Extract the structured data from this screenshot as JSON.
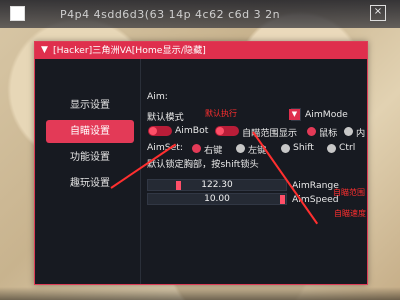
{
  "overlay": {
    "top_text": "P4p4 4sdd6d3(63 14p 4c62 c6d 3 2n",
    "close_symbol": "×"
  },
  "window": {
    "title": "[Hacker]三角洲VA[Home显示/隐藏]",
    "title_arrow": "▼"
  },
  "sidebar": {
    "items": [
      {
        "label": "显示设置",
        "active": false
      },
      {
        "label": "自瞄设置",
        "active": true
      },
      {
        "label": "功能设置",
        "active": false
      },
      {
        "label": "趣玩设置",
        "active": false
      }
    ]
  },
  "content": {
    "aim_label": "Aim:",
    "mode_select": {
      "value": "默认模式",
      "arrow": "▼",
      "label": "AimMode"
    },
    "annotations": {
      "default_execute": "默认执行",
      "aim_range": "自瞄范围",
      "aim_speed": "自瞄速度"
    },
    "toggles": {
      "aimbot": "AimBot",
      "show_range": "自瞄范围显示",
      "mouse": "鼠标",
      "inner": "内"
    },
    "aimset": {
      "label": "AimSet:",
      "right_key": "右键",
      "left_key": "左键",
      "shift": "Shift",
      "ctrl": "Ctrl"
    },
    "note": "默认锁定胸部，按shift锁头",
    "sliders": [
      {
        "value": "122.30",
        "label": "AimRange",
        "fraction": 0.2
      },
      {
        "value": "10.00",
        "label": "AimSpeed",
        "fraction": 0.94
      }
    ]
  },
  "colors": {
    "accent": "#df2f4d",
    "panel_bg": "#171a21",
    "annotation": "#ff2f2f"
  }
}
